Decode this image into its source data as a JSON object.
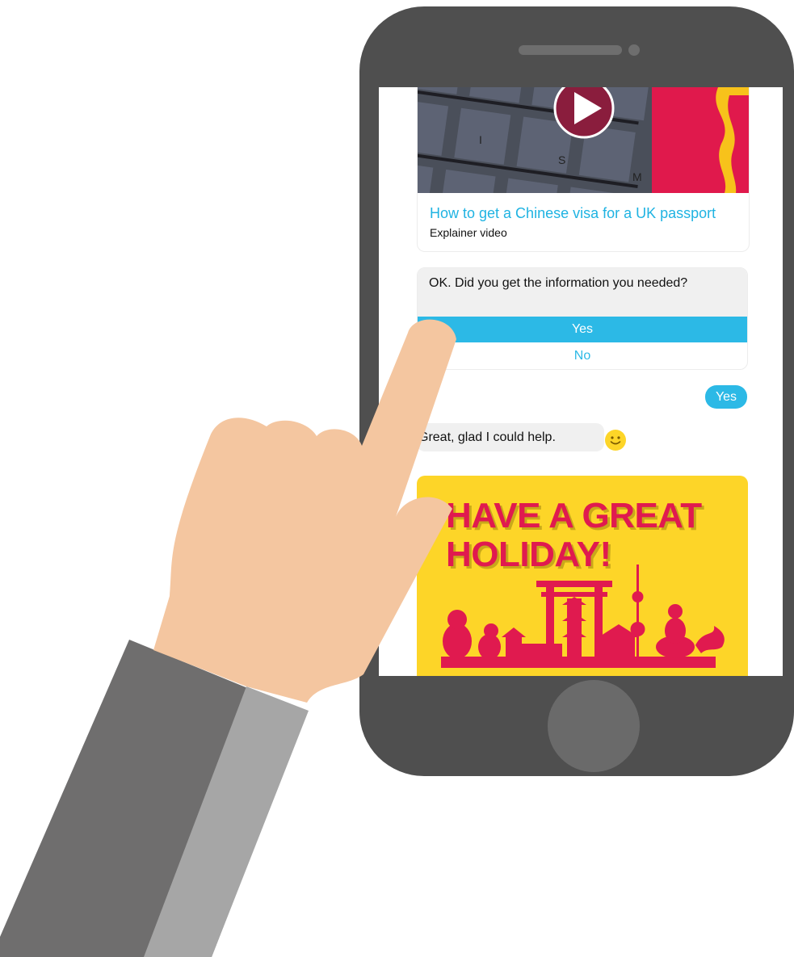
{
  "video": {
    "title": "How to get a Chinese visa for a UK passport",
    "subtitle": "Explainer video",
    "thumbnail_keys": [
      "I",
      "S",
      "M"
    ]
  },
  "question": {
    "text": "OK. Did you get the information you needed?",
    "options": [
      "Yes",
      "No"
    ]
  },
  "user_reply": "Yes",
  "bot_reply": "Great, glad I could help.",
  "holiday_banner": {
    "line1": "HAVE A GREAT",
    "line2": "HOLIDAY!"
  },
  "colors": {
    "accent": "#2cb9e6",
    "banner_yellow": "#fdd528",
    "banner_red": "#e01a4f",
    "phone_body": "#4f4f4f"
  }
}
